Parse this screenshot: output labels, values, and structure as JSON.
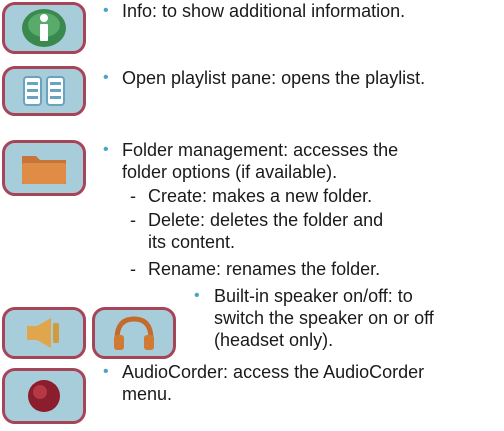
{
  "items": [
    {
      "icon": "info-icon",
      "lines": [
        "Info: to show additional information."
      ]
    },
    {
      "icon": "playlist-pane-icon",
      "lines": [
        "Open playlist pane: opens the playlist."
      ]
    },
    {
      "icon": "folder-icon",
      "lines": [
        "Folder management: accesses the",
        "folder options (if available)."
      ],
      "subitems": [
        {
          "lines": [
            "Create: makes a new folder."
          ]
        },
        {
          "lines": [
            "Delete: deletes the folder and",
            "its content."
          ]
        },
        {
          "lines": [
            "Rename: renames the folder."
          ]
        }
      ]
    },
    {
      "icons": [
        "speaker-icon",
        "headset-icon"
      ],
      "lines": [
        "Built-in speaker on/off: to",
        "switch the speaker on or off",
        "(headset only)."
      ]
    },
    {
      "icon": "audiocorder-icon",
      "lines": [
        "AudioCorder: access the AudioCorder",
        "menu."
      ]
    }
  ],
  "colors": {
    "bullet": "#46a7c2",
    "button_fill": "#a8cdda",
    "button_border": "#a64458"
  }
}
